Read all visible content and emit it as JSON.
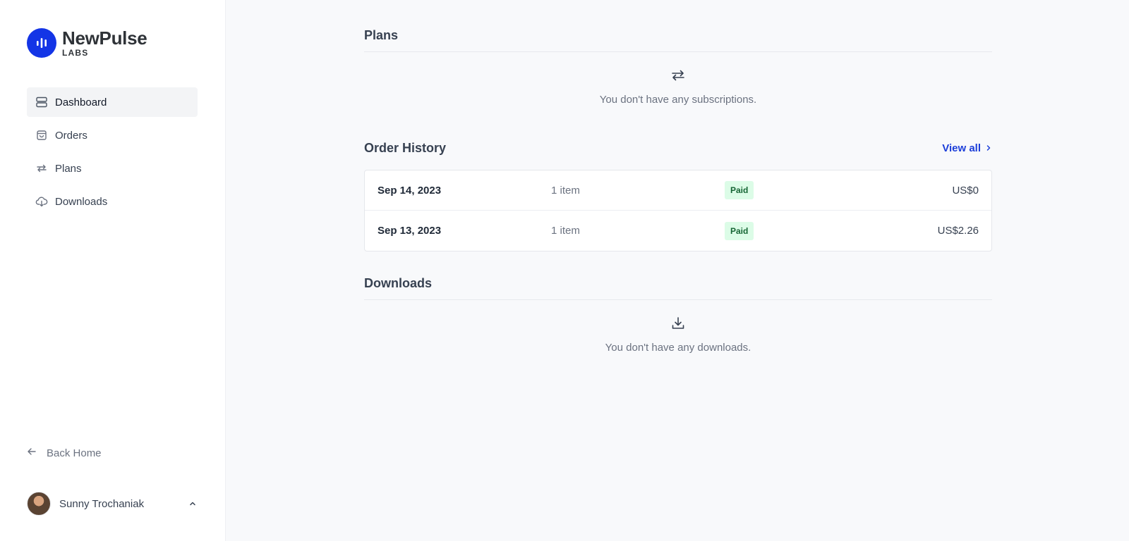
{
  "brand": {
    "name": "NewPulse",
    "sub": "LABS",
    "accent": "#1435e6"
  },
  "sidebar": {
    "nav": [
      {
        "label": "Dashboard",
        "icon": "server-icon",
        "active": true
      },
      {
        "label": "Orders",
        "icon": "shopping-bag-icon",
        "active": false
      },
      {
        "label": "Plans",
        "icon": "repeat-icon",
        "active": false
      },
      {
        "label": "Downloads",
        "icon": "cloud-download-icon",
        "active": false
      }
    ],
    "back_home": "Back Home",
    "user_name": "Sunny Trochaniak"
  },
  "plans": {
    "title": "Plans",
    "empty_text": "You don't have any subscriptions."
  },
  "orders": {
    "title": "Order History",
    "view_all": "View all",
    "rows": [
      {
        "date": "Sep 14, 2023",
        "items": "1 item",
        "status": "Paid",
        "amount": "US$0"
      },
      {
        "date": "Sep 13, 2023",
        "items": "1 item",
        "status": "Paid",
        "amount": "US$2.26"
      }
    ]
  },
  "downloads": {
    "title": "Downloads",
    "empty_text": "You don't have any downloads."
  },
  "colors": {
    "link": "#1d3fd9",
    "badge_bg": "#dcfce7",
    "badge_text": "#166534"
  }
}
